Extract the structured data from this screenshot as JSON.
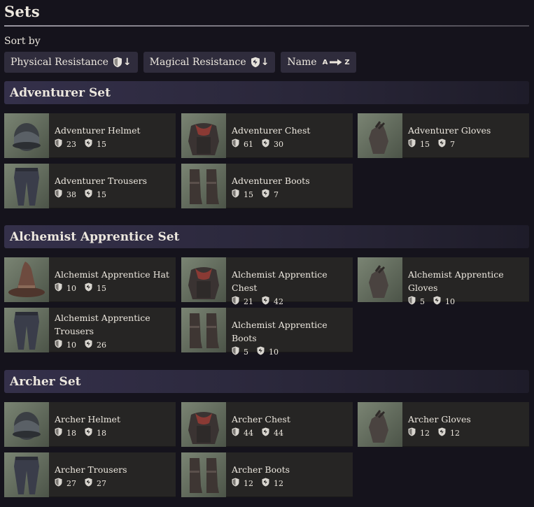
{
  "page": {
    "title": "Sets",
    "sort_label": "Sort by"
  },
  "sort": [
    {
      "label": "Physical Resistance",
      "icon": "shield-sort-down-icon"
    },
    {
      "label": "Magical Resistance",
      "icon": "magic-shield-sort-down-icon"
    },
    {
      "label": "Name",
      "icon": "az-sort-icon",
      "from": "A",
      "to": "Z"
    }
  ],
  "sets": [
    {
      "name": "Adventurer Set",
      "items": [
        {
          "name": "Adventurer Helmet",
          "phys": "23",
          "mag": "15",
          "icon": "helmet-icon"
        },
        {
          "name": "Adventurer Chest",
          "phys": "61",
          "mag": "30",
          "icon": "chest-icon"
        },
        {
          "name": "Adventurer Gloves",
          "phys": "15",
          "mag": "7",
          "icon": "gloves-icon"
        },
        {
          "name": "Adventurer Trousers",
          "phys": "38",
          "mag": "15",
          "icon": "trousers-icon"
        },
        {
          "name": "Adventurer Boots",
          "phys": "15",
          "mag": "7",
          "icon": "boots-icon"
        }
      ]
    },
    {
      "name": "Alchemist Apprentice Set",
      "items": [
        {
          "name": "Alchemist Apprentice Hat",
          "phys": "10",
          "mag": "15",
          "icon": "hat-icon"
        },
        {
          "name": "Alchemist Apprentice Chest",
          "phys": "21",
          "mag": "42",
          "icon": "chest-icon"
        },
        {
          "name": "Alchemist Apprentice Gloves",
          "phys": "5",
          "mag": "10",
          "icon": "gloves-icon"
        },
        {
          "name": "Alchemist Apprentice Trousers",
          "phys": "10",
          "mag": "26",
          "icon": "trousers-icon"
        },
        {
          "name": "Alchemist Apprentice Boots",
          "phys": "5",
          "mag": "10",
          "icon": "boots-icon"
        }
      ]
    },
    {
      "name": "Archer Set",
      "items": [
        {
          "name": "Archer Helmet",
          "phys": "18",
          "mag": "18",
          "icon": "helmet-icon"
        },
        {
          "name": "Archer Chest",
          "phys": "44",
          "mag": "44",
          "icon": "chest-icon"
        },
        {
          "name": "Archer Gloves",
          "phys": "12",
          "mag": "12",
          "icon": "gloves-icon"
        },
        {
          "name": "Archer Trousers",
          "phys": "27",
          "mag": "27",
          "icon": "trousers-icon"
        },
        {
          "name": "Archer Boots",
          "phys": "12",
          "mag": "12",
          "icon": "boots-icon"
        }
      ]
    }
  ],
  "colors": {
    "background": "#15131c",
    "card": "#262524",
    "sort_button": "#2f2c3c",
    "section_bar": "#34304a",
    "text": "#ece7de",
    "stat_icon": "#d9d6d0"
  }
}
